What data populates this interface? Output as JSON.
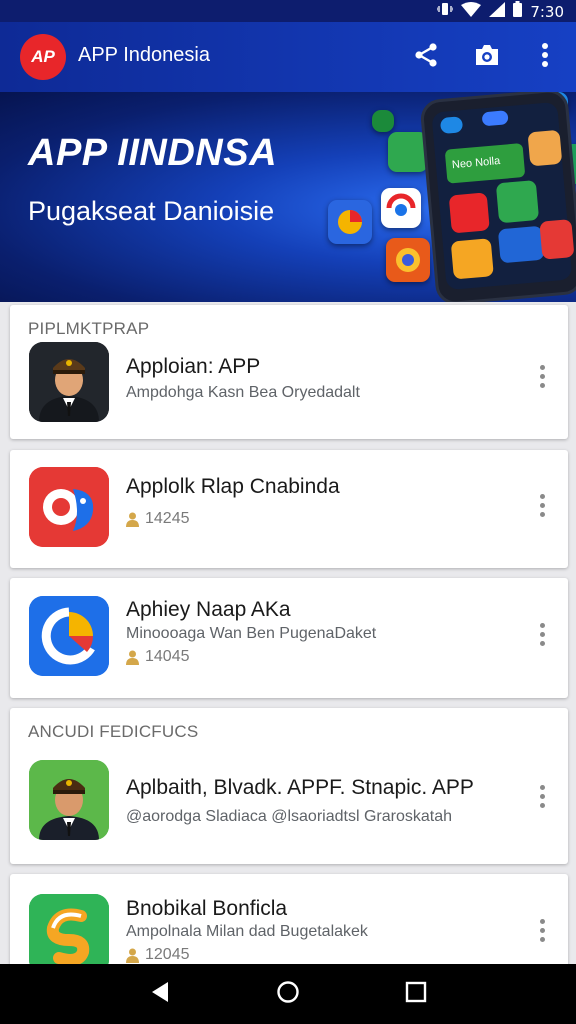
{
  "status_bar": {
    "time": "7:30"
  },
  "app_bar": {
    "logo_text": "AP",
    "title": "APP Indonesia",
    "actions": [
      "share-icon",
      "camera-icon",
      "more-vert-icon"
    ]
  },
  "banner": {
    "title": "APP IINDNSA",
    "subtitle": "Pugakseat Danioisie",
    "phone_label": "Neo Nolla"
  },
  "sections": [
    {
      "heading": "PIPLMKTPRAP",
      "items": [
        {
          "title": "Apploian: APP",
          "subtitle": "Ampdohga Kasn Bea Oryedadalt",
          "meta": ""
        },
        {
          "title": "Applolk Rlap Cnabinda",
          "subtitle": "",
          "meta": "14245"
        },
        {
          "title": "Aphiey Naap AKa",
          "subtitle": "Minoooaga Wan Ben PugenaDaket",
          "meta": "14045"
        }
      ]
    },
    {
      "heading": "ANCUDI FEDICFUCS",
      "items": [
        {
          "title": "Aplbaith, Blvadk. APPF. Stnapic. APP",
          "subtitle": "@aorodga Sladiaca @lsaoriadtsl Graroskatah",
          "meta": ""
        },
        {
          "title": "Bnobikal Bonficla",
          "subtitle": "Ampolnala Milan dad Bugetalakek",
          "meta": "12045"
        }
      ]
    }
  ],
  "nav": [
    "back-icon",
    "home-icon",
    "recents-icon"
  ]
}
